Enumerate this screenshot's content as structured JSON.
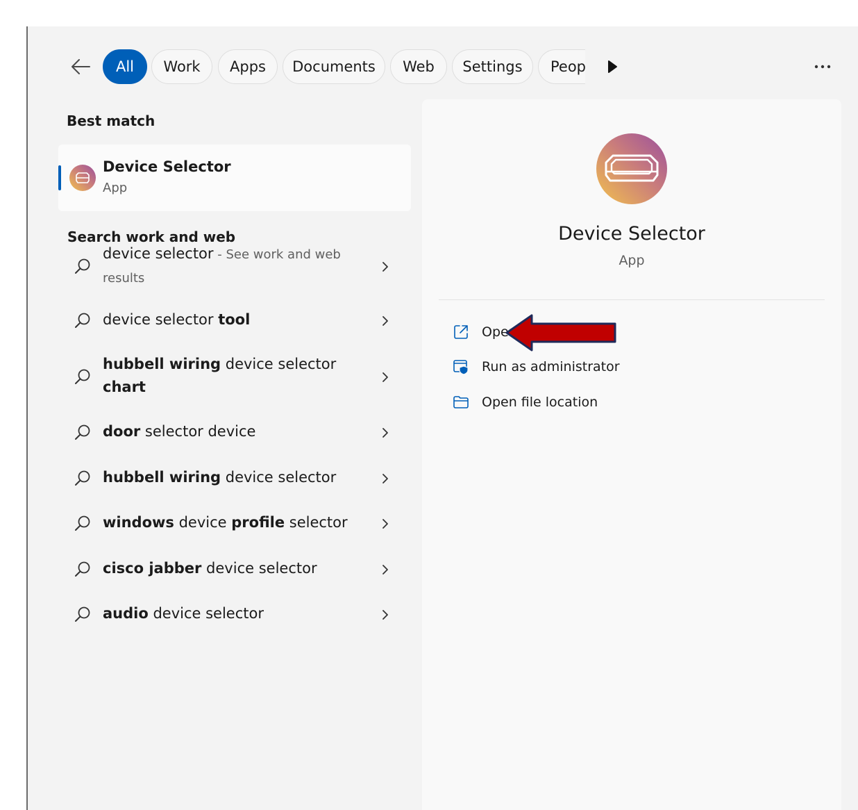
{
  "filters": {
    "tabs": [
      {
        "label": "All",
        "active": true
      },
      {
        "label": "Work",
        "active": false
      },
      {
        "label": "Apps",
        "active": false
      },
      {
        "label": "Documents",
        "active": false
      },
      {
        "label": "Web",
        "active": false
      },
      {
        "label": "Settings",
        "active": false
      },
      {
        "label": "Peop",
        "active": false
      }
    ],
    "icons": {
      "back": "back-arrow-icon",
      "next": "play-next-icon",
      "more": "more-icon"
    }
  },
  "best_match": {
    "heading": "Best match",
    "name": "Device Selector",
    "type": "App"
  },
  "search_web": {
    "heading": "Search work and web",
    "items": [
      {
        "parts": [
          {
            "t": "device selector",
            "b": false
          },
          {
            "t": " - See work and web results",
            "b": false,
            "hint": true
          }
        ]
      },
      {
        "parts": [
          {
            "t": "device selector ",
            "b": false
          },
          {
            "t": "tool",
            "b": true
          }
        ]
      },
      {
        "parts": [
          {
            "t": "hubbell wiring",
            "b": true
          },
          {
            "t": " device selector ",
            "b": false
          },
          {
            "t": "chart",
            "b": true
          }
        ]
      },
      {
        "parts": [
          {
            "t": "door",
            "b": true
          },
          {
            "t": " selector device",
            "b": false
          }
        ]
      },
      {
        "parts": [
          {
            "t": "hubbell wiring",
            "b": true
          },
          {
            "t": " device selector",
            "b": false
          }
        ]
      },
      {
        "parts": [
          {
            "t": "windows",
            "b": true
          },
          {
            "t": " device ",
            "b": false
          },
          {
            "t": "profile",
            "b": true
          },
          {
            "t": " selector",
            "b": false
          }
        ]
      },
      {
        "parts": [
          {
            "t": "cisco jabber",
            "b": true
          },
          {
            "t": " device selector",
            "b": false
          }
        ]
      },
      {
        "parts": [
          {
            "t": "audio",
            "b": true
          },
          {
            "t": " device selector",
            "b": false
          }
        ]
      }
    ]
  },
  "detail": {
    "name": "Device Selector",
    "type": "App",
    "actions": [
      {
        "label": "Open",
        "icon": "open-external-icon"
      },
      {
        "label": "Run as administrator",
        "icon": "admin-shield-icon"
      },
      {
        "label": "Open file location",
        "icon": "folder-icon"
      }
    ]
  },
  "colors": {
    "accent": "#005fb8",
    "arrow": "#c00000",
    "arrow_outline": "#1f2a5a"
  }
}
